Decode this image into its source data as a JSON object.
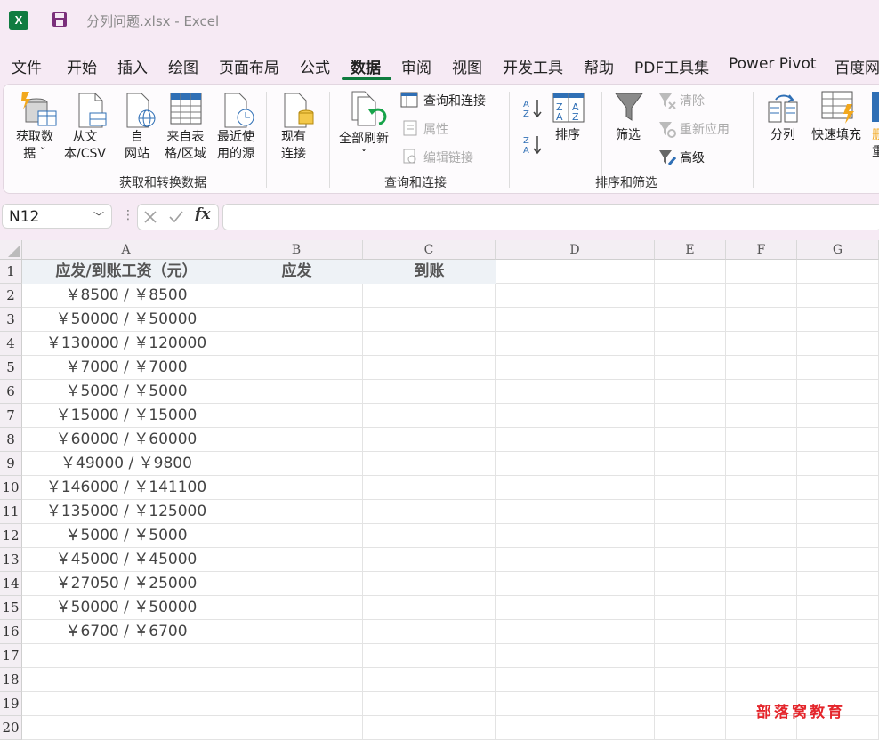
{
  "app": {
    "logo_letter": "X",
    "doc_title": "分列问题.xlsx  -  Excel"
  },
  "menu": [
    "文件",
    "开始",
    "插入",
    "绘图",
    "页面布局",
    "公式",
    "数据",
    "审阅",
    "视图",
    "开发工具",
    "帮助",
    "PDF工具集",
    "Power Pivot",
    "百度网"
  ],
  "menu_active": "数据",
  "ribbon": {
    "get_data_l1": "获取数",
    "get_data_l2": "据 ˇ",
    "from_text_l1": "从文",
    "from_text_l2": "本/CSV",
    "from_web_l1": "自",
    "from_web_l2": "网站",
    "from_table_l1": "来自表",
    "from_table_l2": "格/区域",
    "recent_l1": "最近使",
    "recent_l2": "用的源",
    "existing_l1": "现有",
    "existing_l2": "连接",
    "group_get": "获取和转换数据",
    "refresh_all": "全部刷新",
    "refresh_caret": "ˇ",
    "queries_connections": "查询和连接",
    "properties": "属性",
    "edit_links": "编辑链接",
    "group_queries": "查询和连接",
    "sort": "排序",
    "filter": "筛选",
    "clear": "清除",
    "reapply": "重新应用",
    "advanced": "高级",
    "group_sort": "排序和筛选",
    "text_to_columns": "分列",
    "flash_fill": "快速填充",
    "partial_a": "删",
    "partial_b": "重"
  },
  "formula_bar": {
    "name_box": "N12",
    "fx": "fx",
    "formula": ""
  },
  "columns": [
    "A",
    "B",
    "C",
    "D",
    "E",
    "F",
    "G"
  ],
  "headers": {
    "A": "应发/到账工资（元）",
    "B": "应发",
    "C": "到账"
  },
  "rows": [
    "1",
    "2",
    "3",
    "4",
    "5",
    "6",
    "7",
    "8",
    "9",
    "10",
    "11",
    "12",
    "13",
    "14",
    "15",
    "16",
    "17",
    "18",
    "19",
    "20"
  ],
  "values": [
    "￥8500 / ￥8500",
    "￥50000 / ￥50000",
    "￥130000 / ￥120000",
    "￥7000 / ￥7000",
    "￥5000 / ￥5000",
    "￥15000 / ￥15000",
    "￥60000 / ￥60000",
    "￥49000 / ￥9800",
    "￥146000 / ￥141100",
    "￥135000 / ￥125000",
    "￥5000 / ￥5000",
    "￥45000 / ￥45000",
    "￥27050 / ￥25000",
    "￥50000 / ￥50000",
    "￥6700 / ￥6700"
  ],
  "watermark": "部落窝教育",
  "colors": {
    "excel_green": "#107c41",
    "header_fill": "#eef2f6",
    "watermark": "#e4252b"
  }
}
